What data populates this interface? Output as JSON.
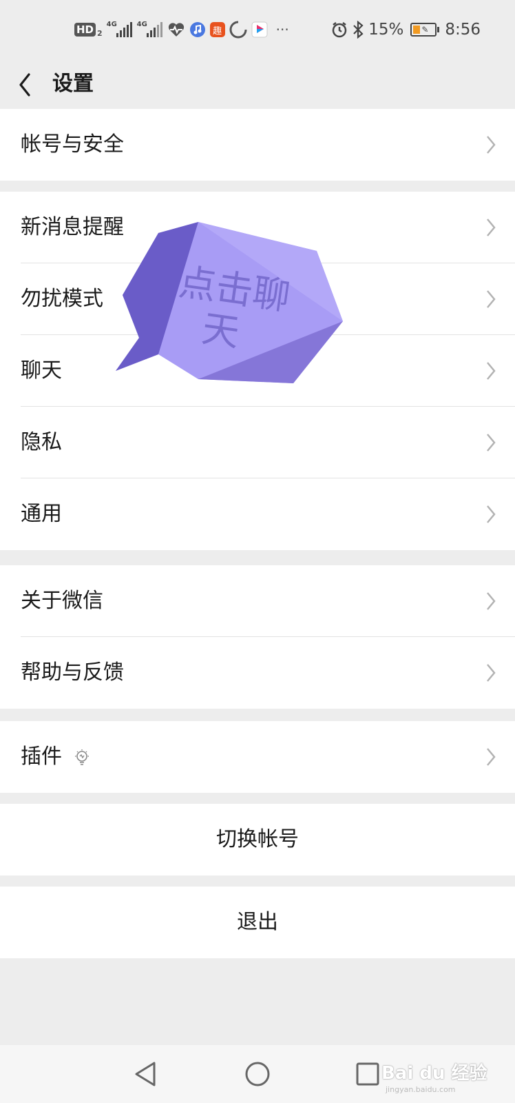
{
  "status_bar": {
    "hd_label": "HD",
    "hd_sub": "2",
    "signal1_label": "4G",
    "signal2_label": "4G",
    "qu_app": "趣",
    "more": "···",
    "battery_percent": "15%",
    "time": "8:56"
  },
  "header": {
    "title": "设置"
  },
  "groups": [
    {
      "items": [
        {
          "label": "帐号与安全"
        }
      ]
    },
    {
      "items": [
        {
          "label": "新消息提醒"
        },
        {
          "label": "勿扰模式"
        },
        {
          "label": "聊天"
        },
        {
          "label": "隐私"
        },
        {
          "label": "通用"
        }
      ]
    },
    {
      "items": [
        {
          "label": "关于微信"
        },
        {
          "label": "帮助与反馈"
        }
      ]
    },
    {
      "items": [
        {
          "label": "插件"
        }
      ]
    }
  ],
  "actions": {
    "switch_account": "切换帐号",
    "logout": "退出"
  },
  "annotation": {
    "line1": "点击聊",
    "line2": "天"
  },
  "watermark": {
    "text": "Bai du 经验",
    "url": "jingyan.baidu.com"
  },
  "colors": {
    "background": "#ededed",
    "annotation_bubble": "#a89cf5",
    "annotation_shadow": "#6a5cc8"
  }
}
